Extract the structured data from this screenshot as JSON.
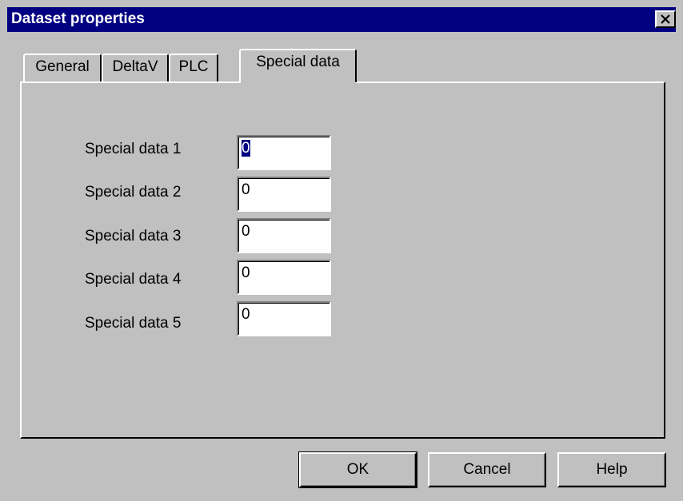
{
  "window": {
    "title": "Dataset properties",
    "close_icon": "close-icon"
  },
  "tabs": [
    {
      "label": "General",
      "active": false
    },
    {
      "label": "DeltaV",
      "active": false
    },
    {
      "label": "PLC",
      "active": false
    },
    {
      "label": "Special data",
      "active": true
    }
  ],
  "fields": [
    {
      "label": "Special data 1",
      "value": "0",
      "selected": true
    },
    {
      "label": "Special data 2",
      "value": "0"
    },
    {
      "label": "Special data 3",
      "value": "0"
    },
    {
      "label": "Special data 4",
      "value": "0"
    },
    {
      "label": "Special data 5",
      "value": "0"
    }
  ],
  "buttons": {
    "ok": "OK",
    "cancel": "Cancel",
    "help": "Help"
  },
  "colors": {
    "titlebar": "#000080",
    "face": "#c0c0c0",
    "selection": "#000080"
  }
}
